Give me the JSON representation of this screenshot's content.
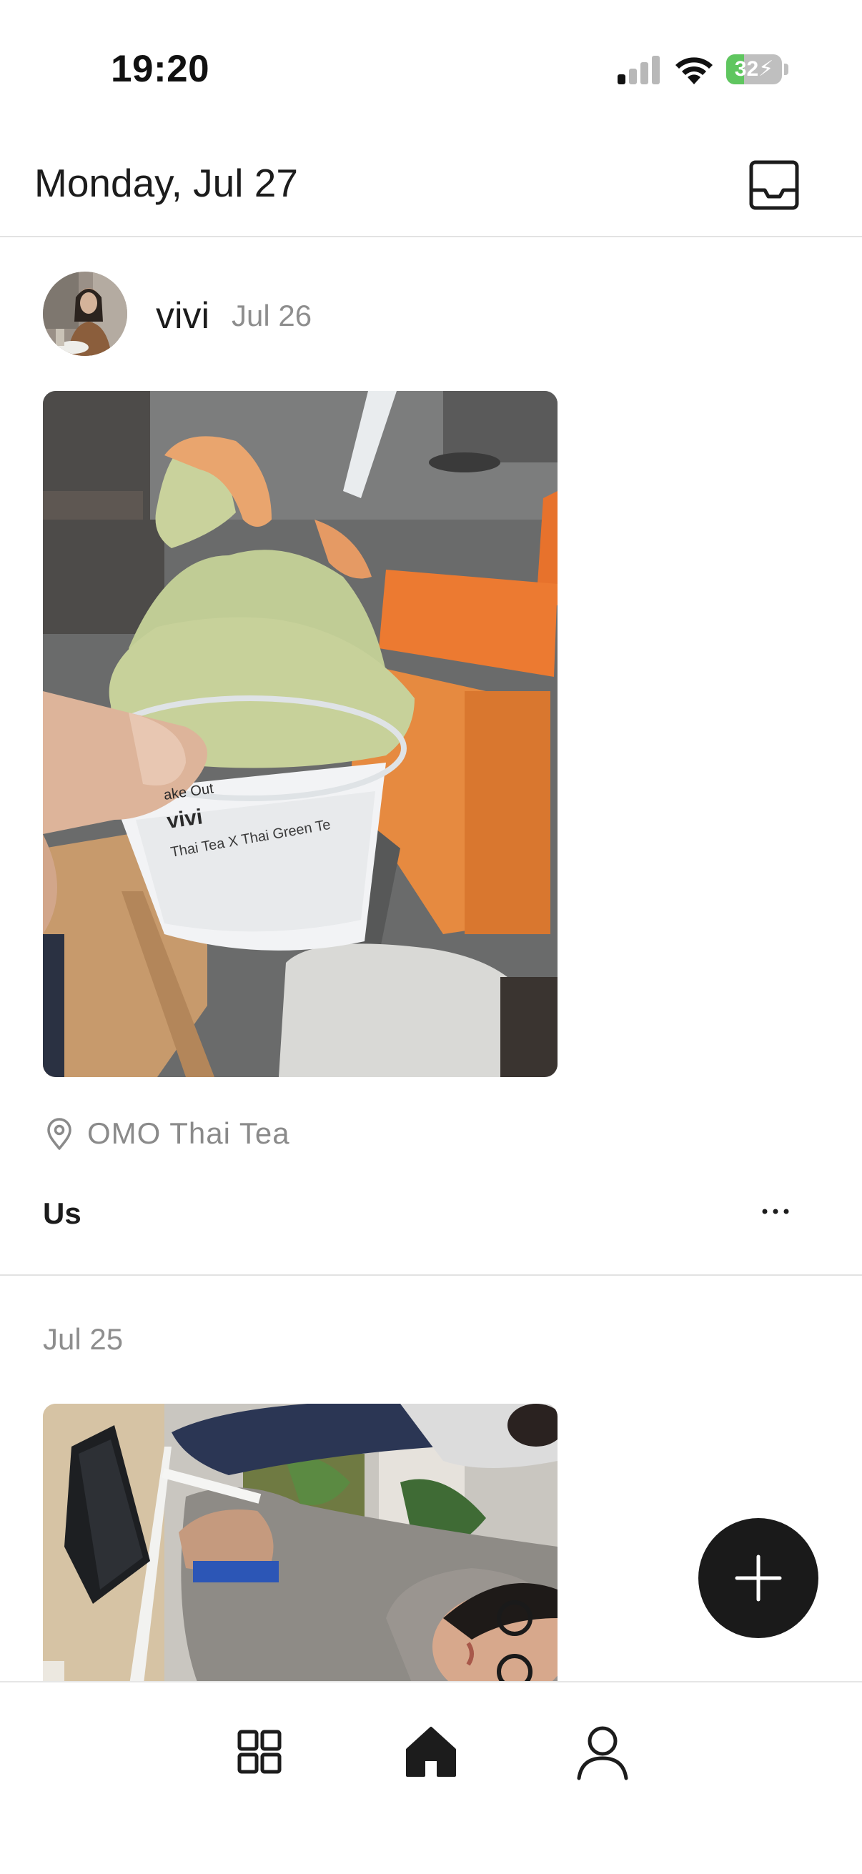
{
  "status_bar": {
    "time": "19:20",
    "battery_level": "32",
    "icons": [
      "cellular-signal-icon",
      "wifi-icon",
      "battery-charging-icon"
    ]
  },
  "header": {
    "date": "Monday, Jul 27",
    "inbox_icon": "inbox-tray-icon"
  },
  "feed": {
    "post": {
      "username": "vivi",
      "date": "Jul 26",
      "location_icon": "location-pin-icon",
      "location": "OMO Thai Tea",
      "caption": "Us",
      "more_icon": "more-ellipsis-icon"
    },
    "next_section": {
      "date": "Jul 25"
    }
  },
  "fab": {
    "icon": "plus-icon"
  },
  "tab_bar": {
    "tabs": [
      {
        "icon": "grid-icon",
        "selected": false
      },
      {
        "icon": "home-icon",
        "selected": true
      },
      {
        "icon": "profile-icon",
        "selected": false
      }
    ]
  },
  "colors": {
    "text_primary": "#1c1c1c",
    "text_secondary": "#8e8e8e",
    "fab_background": "#1a1a1a",
    "battery_green": "#5fc65f",
    "divider": "#e2e2e2"
  }
}
